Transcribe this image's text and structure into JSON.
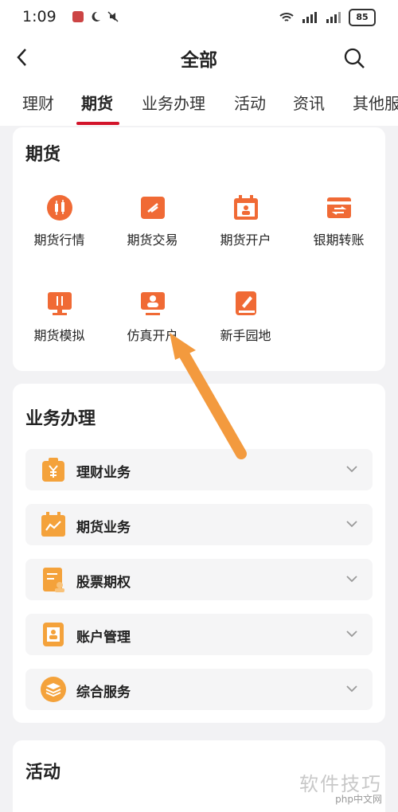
{
  "status": {
    "time": "1:09",
    "battery": "85"
  },
  "header": {
    "title": "全部"
  },
  "tabs": [
    {
      "label": "理财"
    },
    {
      "label": "期货"
    },
    {
      "label": "业务办理"
    },
    {
      "label": "活动"
    },
    {
      "label": "资讯"
    },
    {
      "label": "其他服"
    }
  ],
  "futures": {
    "title": "期货",
    "items": [
      {
        "label": "期货行情",
        "icon": "candlestick-chart-icon"
      },
      {
        "label": "期货交易",
        "icon": "trade-ticket-icon"
      },
      {
        "label": "期货开户",
        "icon": "calendar-user-icon"
      },
      {
        "label": "银期转账",
        "icon": "card-transfer-icon"
      },
      {
        "label": "期货模拟",
        "icon": "monitor-chart-icon"
      },
      {
        "label": "仿真开户",
        "icon": "monitor-user-icon"
      },
      {
        "label": "新手园地",
        "icon": "book-pen-icon"
      }
    ]
  },
  "business": {
    "title": "业务办理",
    "rows": [
      {
        "label": "理财业务",
        "icon": "wealth-bag-icon"
      },
      {
        "label": "期货业务",
        "icon": "calendar-chart-icon"
      },
      {
        "label": "股票期权",
        "icon": "document-user-icon"
      },
      {
        "label": "账户管理",
        "icon": "account-card-icon"
      },
      {
        "label": "综合服务",
        "icon": "layers-icon"
      }
    ]
  },
  "activity": {
    "title": "活动"
  },
  "watermark": {
    "text": "软件技巧",
    "logo": "php中文网"
  },
  "colors": {
    "accent": "#d2142a",
    "icon_orange": "#f06a35",
    "row_icon_orange": "#f4a23b"
  }
}
